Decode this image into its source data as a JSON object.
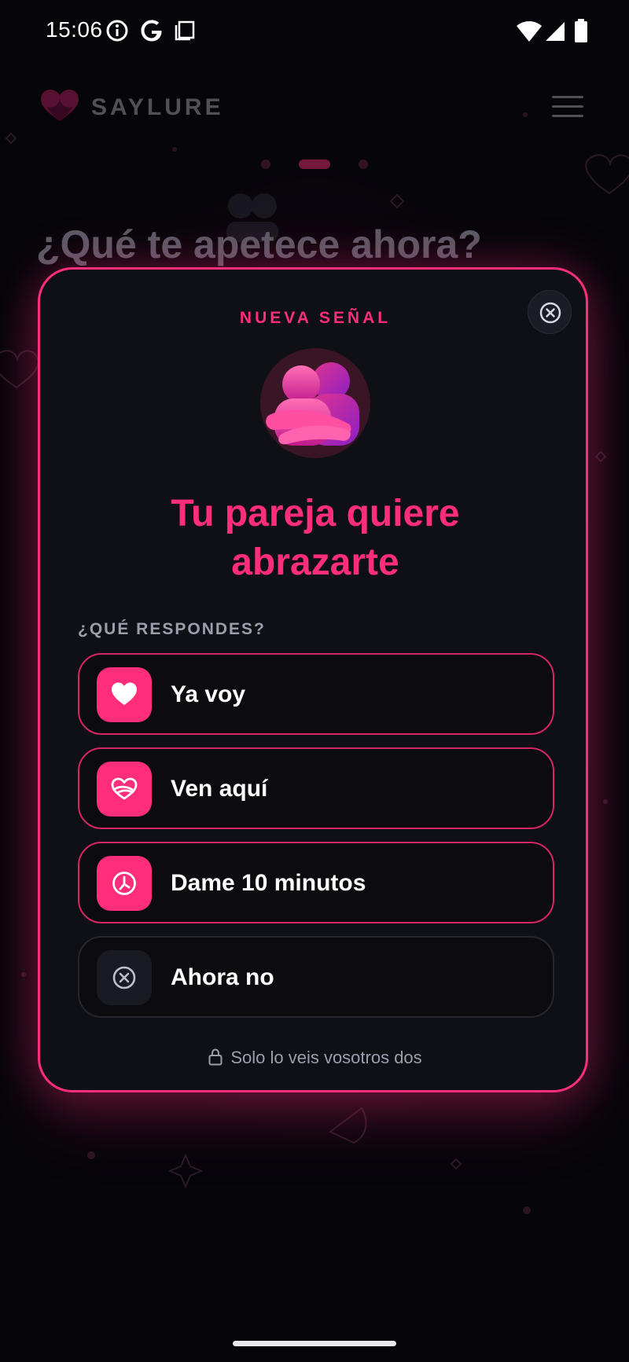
{
  "status_bar": {
    "time": "15:06",
    "left_icons": [
      "info-icon",
      "google-icon",
      "screenshot-icon"
    ],
    "right_icons": [
      "wifi-icon",
      "signal-icon",
      "battery-icon"
    ]
  },
  "app": {
    "name": "SAYLURE",
    "logo_icon": "heart-logo-icon",
    "menu_icon": "hamburger-menu-icon",
    "background_title": "¿Qué te apetece ahora?"
  },
  "pager": {
    "count": 3,
    "active_index": 1
  },
  "modal": {
    "eyebrow": "NUEVA SEÑAL",
    "emoji_icon": "people-hugging-icon",
    "headline_line1": "Tu pareja quiere",
    "headline_line2": "abrazarte",
    "section_label": "¿QUÉ RESPONDES?",
    "close_icon": "close-circle-icon",
    "options": [
      {
        "label": "Ya voy",
        "icon": "heart-icon"
      },
      {
        "label": "Ven aquí",
        "icon": "hug-heart-icon"
      },
      {
        "label": "Dame 10 minutos",
        "icon": "timer-icon"
      },
      {
        "label": "Ahora no",
        "icon": "close-circle-icon"
      }
    ],
    "privacy_text": "Solo lo veis vosotros dos",
    "privacy_icon": "lock-icon"
  },
  "colors": {
    "accent": "#ff2d7a",
    "background": "#05050a",
    "card": "#0f1016",
    "muted_text": "#9e9eab"
  }
}
